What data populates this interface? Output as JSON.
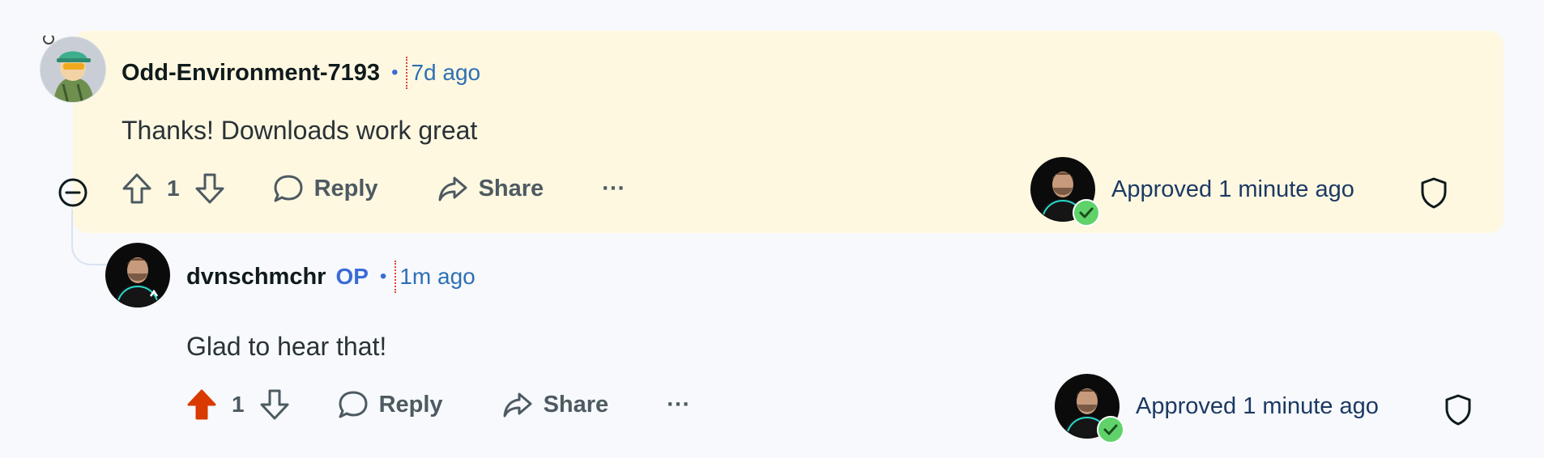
{
  "parent_comment": {
    "username": "Odd-Environment-7193",
    "separator": "•",
    "time": "7d ago",
    "body": "Thanks! Downloads work great",
    "vote_count": "1",
    "reply_label": "Reply",
    "share_label": "Share",
    "more_label": "···",
    "approval_text": "Approved 1 minute ago",
    "highlight_color": "#fef8e1"
  },
  "reply_comment": {
    "username": "dvnschmchr",
    "op_badge": "OP",
    "separator": "•",
    "time": "1m ago",
    "body": "Glad to hear that!",
    "vote_count": "1",
    "reply_label": "Reply",
    "share_label": "Share",
    "more_label": "···",
    "approval_text": "Approved 1 minute ago",
    "upvote_color": "#d93a00"
  },
  "icons": {
    "collapse": "minus-circle-icon",
    "upvote": "arrow-up-icon",
    "downvote": "arrow-down-icon",
    "reply": "speech-bubble-icon",
    "share": "share-arrow-icon",
    "shield": "shield-icon",
    "approved": "check-badge-icon"
  }
}
